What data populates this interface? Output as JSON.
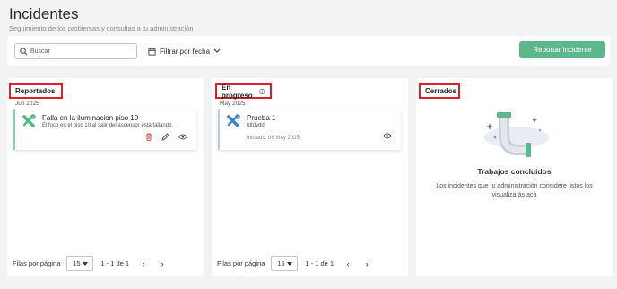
{
  "header": {
    "title": "Incidentes",
    "subtitle": "Seguimiento de los problemas y consultas a tu administración"
  },
  "toolbar": {
    "search_placeholder": "Buscar",
    "filter_label": "Filtrar por fecha",
    "report_button": "Reportar incidente"
  },
  "columns": [
    {
      "title": "Reportados",
      "group": "Jun 2025",
      "card": {
        "title": "Falla en la iluminacion piso 10",
        "description": "El foco en el piso 10 al salir del ascensor esta fallando.",
        "accent": "#7ed7a4",
        "icon": "tools-icon"
      },
      "pager": {
        "label": "Filas por página",
        "per_page": "15",
        "range": "1 - 1 de 1",
        "prev": "‹",
        "next": "›"
      }
    },
    {
      "title": "En progreso",
      "group": "May 2025",
      "card": {
        "title": "Prueba 1",
        "description": "fdfdvdd",
        "date": "Iniciado: 08 May 2025",
        "accent": "#b8c9e6",
        "icon": "tools-icon"
      },
      "pager": {
        "label": "Filas por página",
        "per_page": "15",
        "range": "1 - 1 de 1",
        "prev": "‹",
        "next": "›"
      }
    },
    {
      "title": "Cerrados",
      "empty": {
        "title": "Trabajos concluidos",
        "description": "Los incidentes que tu administración considere listos los visualizarás acá"
      }
    }
  ],
  "colors": {
    "accent_green": "#5cb88a",
    "highlight_red": "#d9202b",
    "delete_red": "#e05a5a"
  }
}
